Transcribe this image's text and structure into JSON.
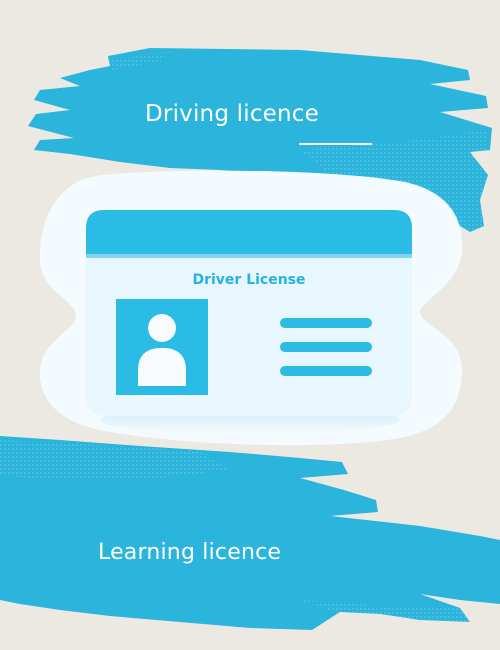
{
  "labels": {
    "top": "Driving licence",
    "bottom": "Learning licence"
  },
  "card": {
    "title": "Driver License"
  },
  "colors": {
    "background": "#ece9e2",
    "brush": "#2bb4dc",
    "card_header": "#2bbce6",
    "card_body": "#e7f7fd",
    "card_title_text": "#27b2df"
  },
  "icons": [
    "person-icon"
  ]
}
